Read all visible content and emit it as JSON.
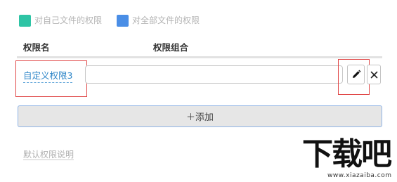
{
  "legend": {
    "items": [
      {
        "label": "对自己文件的权限",
        "color": "#2ec4a5"
      },
      {
        "label": "对全部文件的权限",
        "color": "#4a8ee6"
      }
    ]
  },
  "table": {
    "headers": {
      "name": "权限名",
      "combo": "权限组合"
    },
    "rows": [
      {
        "name": "自定义权限3",
        "combo_value": ""
      }
    ]
  },
  "buttons": {
    "edit_icon": "pencil-icon",
    "delete_icon": "close-icon",
    "add_label": "＋添加"
  },
  "help_link": "默认权限说明",
  "watermark": {
    "logo_text": "下载吧",
    "url": "www.xiazaiba.com"
  },
  "colors": {
    "link": "#2e86c8",
    "highlight": "#e04646",
    "primary": "#2e86d6"
  }
}
